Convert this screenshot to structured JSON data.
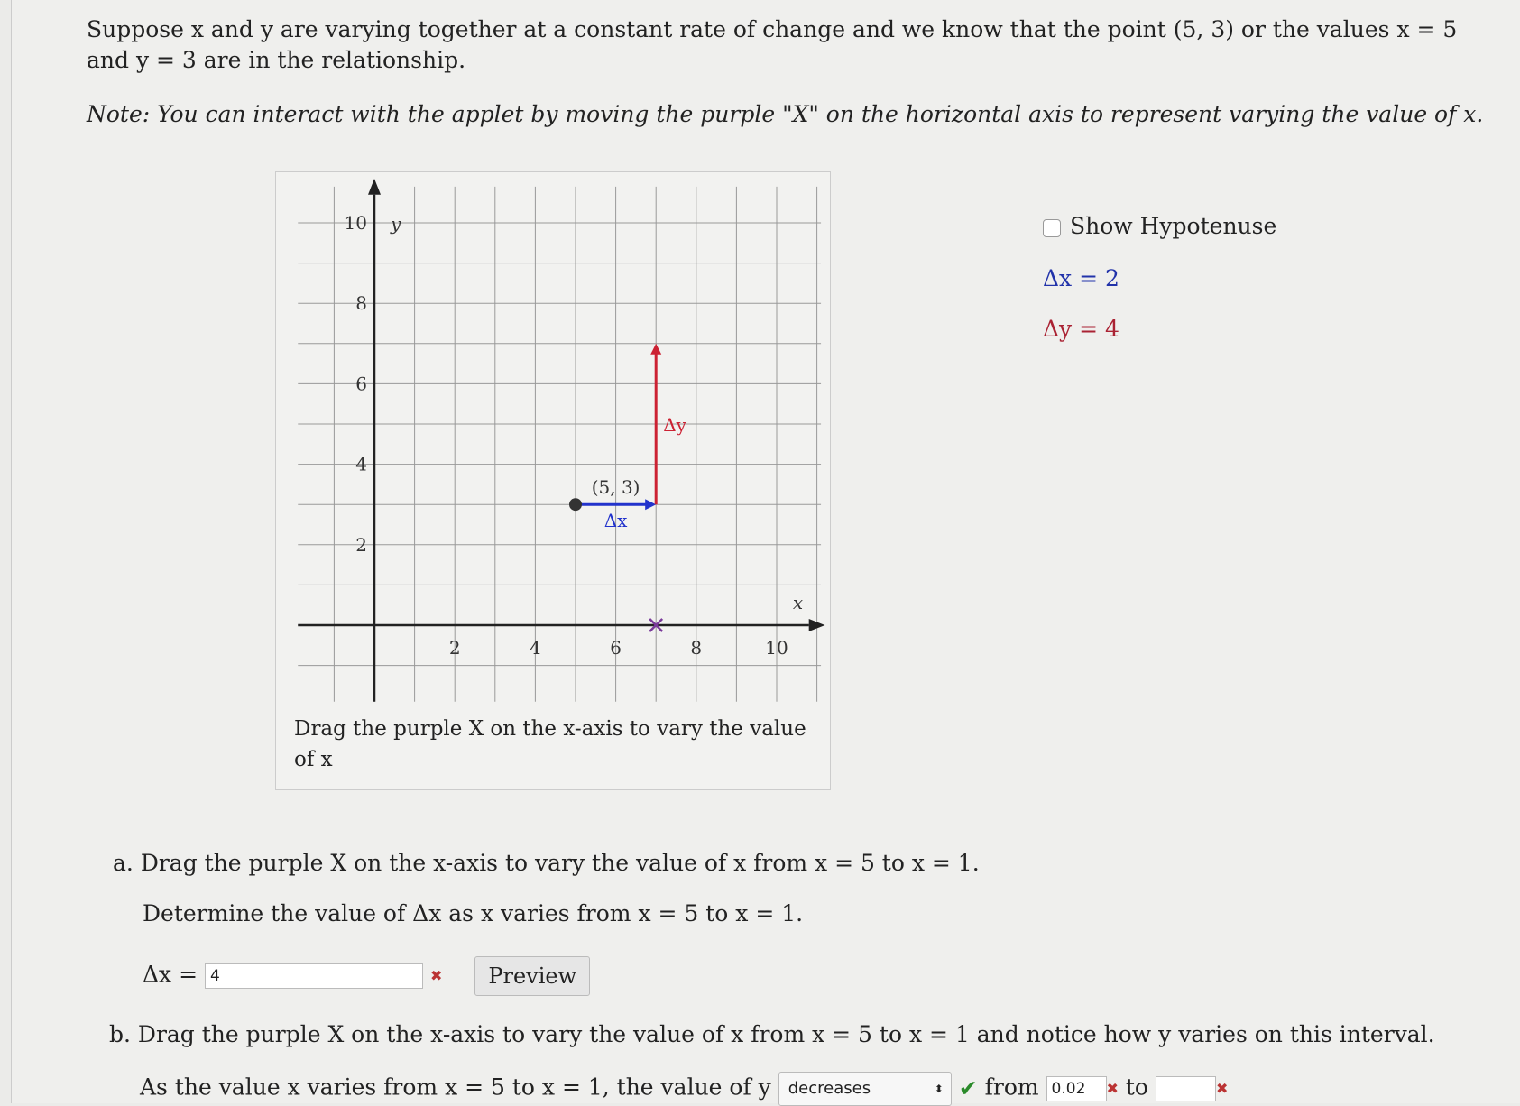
{
  "intro": "Suppose x and y are varying together at a constant rate of change and we know that the point (5, 3) or the values x = 5 and y = 3 are in the relationship.",
  "note": "Note: You can interact with the applet by moving the purple \"X\" on the horizontal axis to represent varying the value of x.",
  "applet": {
    "caption": "Drag the purple X on the x-axis to vary the value of x",
    "x_ticks": [
      "2",
      "4",
      "6",
      "8",
      "10"
    ],
    "y_ticks": [
      "2",
      "4",
      "6",
      "8",
      "10"
    ],
    "x_axis_label": "x",
    "y_axis_label": "y",
    "point_label": "(5, 3)",
    "point": [
      5,
      3
    ],
    "dx_label": "Δx",
    "dy_label": "Δy",
    "dx_value": 2,
    "dy_value": 4,
    "colors": {
      "dx": "#2233cc",
      "dy": "#cc2233",
      "marker": "#7a3a9a"
    }
  },
  "side": {
    "show_hypotenuse": "Show Hypotenuse",
    "hypotenuse_checked": false,
    "dx_readout": "Δx = 2",
    "dy_readout": "Δy = 4"
  },
  "part_a": {
    "label": "a.",
    "text": "Drag the purple X on the x-axis to vary the value of x from x = 5 to x = 1.",
    "question": "Determine the value of Δx as x varies from x = 5 to x = 1.",
    "answer_label": "Δx =",
    "answer_value": "4",
    "answer_status": "incorrect",
    "preview": "Preview"
  },
  "part_b": {
    "label": "b.",
    "text": "Drag the purple X on the x-axis to vary the value of x from x = 5 to x = 1 and notice how y varies on this interval.",
    "sentence_start": "As the value x varies from x = 5 to x = 1, the value of y",
    "select_value": "decreases",
    "select_status": "correct",
    "from_label": "from",
    "from_value": "0.02",
    "to_label": "to",
    "to_value": ""
  }
}
